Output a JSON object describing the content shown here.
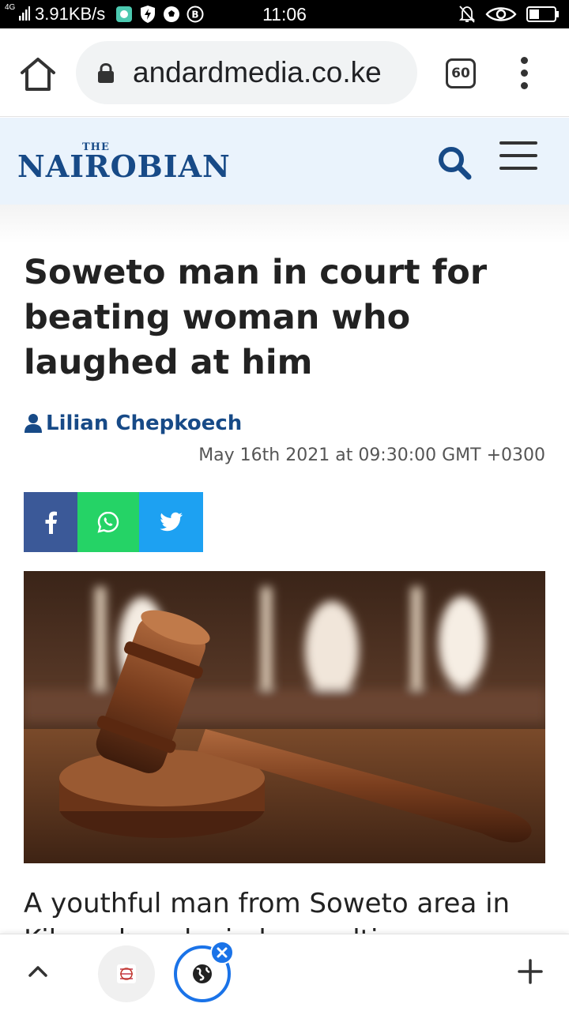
{
  "status_bar": {
    "network": "4G",
    "speed": "3.91KB/s",
    "time": "11:06",
    "left_icons": [
      "app-icon",
      "shield-bolt-icon",
      "soccer-ball-icon",
      "b-circle-icon"
    ],
    "right_icons": [
      "bell-off-icon",
      "eye-icon",
      "battery-icon"
    ]
  },
  "browser": {
    "url": "andardmedia.co.ke",
    "tab_count": "60"
  },
  "site": {
    "logo_the": "THE",
    "logo_name": "NAIROBIAN",
    "brand_color": "#174a87"
  },
  "article": {
    "headline": "Soweto man in court for beating woman who laughed at him",
    "author": "Lilian Chepkoech",
    "date": "May 16th 2021 at 09:30:00 GMT +0300",
    "share": [
      {
        "network": "facebook",
        "icon": "facebook-icon",
        "color": "#3b5998"
      },
      {
        "network": "whatsapp",
        "icon": "whatsapp-icon",
        "color": "#25d366"
      },
      {
        "network": "twitter",
        "icon": "twitter-icon",
        "color": "#1da1f2"
      }
    ],
    "image_subject": "gavel",
    "lead_line1": "A youthful man from Soweto area in",
    "lead_line2": "Kibera has denied assaulting a"
  },
  "bottom_nav": {
    "icons": [
      "chevron-up-icon",
      "tab-thumbnail",
      "globe-icon",
      "close-icon",
      "plus-icon"
    ]
  }
}
